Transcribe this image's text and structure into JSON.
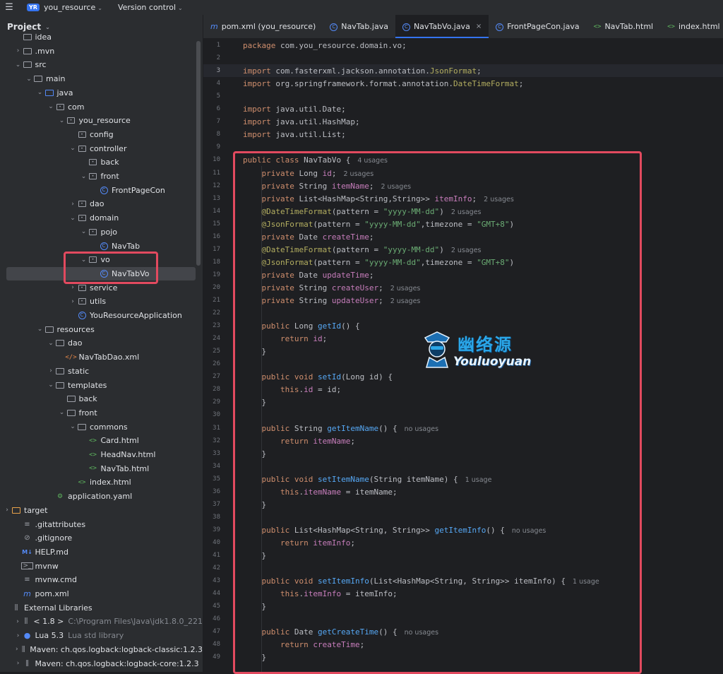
{
  "topbar": {
    "badge": "YR",
    "project": "you_resource",
    "version_control": "Version control"
  },
  "sidebar": {
    "title": "Project",
    "tree": [
      {
        "label": "idea",
        "depth": 1,
        "arrow": "",
        "icon": "folder"
      },
      {
        "label": ".mvn",
        "depth": 1,
        "arrow": "›",
        "icon": "folder"
      },
      {
        "label": "src",
        "depth": 1,
        "arrow": "⌄",
        "icon": "folder"
      },
      {
        "label": "main",
        "depth": 2,
        "arrow": "⌄",
        "icon": "folder"
      },
      {
        "label": "java",
        "depth": 3,
        "arrow": "⌄",
        "icon": "folder-blue"
      },
      {
        "label": "com",
        "depth": 4,
        "arrow": "⌄",
        "icon": "package"
      },
      {
        "label": "you_resource",
        "depth": 5,
        "arrow": "⌄",
        "icon": "package"
      },
      {
        "label": "config",
        "depth": 6,
        "arrow": "",
        "icon": "package"
      },
      {
        "label": "controller",
        "depth": 6,
        "arrow": "⌄",
        "icon": "package"
      },
      {
        "label": "back",
        "depth": 7,
        "arrow": "",
        "icon": "package"
      },
      {
        "label": "front",
        "depth": 7,
        "arrow": "⌄",
        "icon": "package"
      },
      {
        "label": "FrontPageCon",
        "depth": 8,
        "arrow": "",
        "icon": "class"
      },
      {
        "label": "dao",
        "depth": 6,
        "arrow": "›",
        "icon": "package"
      },
      {
        "label": "domain",
        "depth": 6,
        "arrow": "⌄",
        "icon": "package"
      },
      {
        "label": "pojo",
        "depth": 7,
        "arrow": "⌄",
        "icon": "package"
      },
      {
        "label": "NavTab",
        "depth": 8,
        "arrow": "",
        "icon": "class"
      },
      {
        "label": "vo",
        "depth": 7,
        "arrow": "⌄",
        "icon": "package"
      },
      {
        "label": "NavTabVo",
        "depth": 8,
        "arrow": "",
        "icon": "class",
        "selected": true
      },
      {
        "label": "service",
        "depth": 6,
        "arrow": "›",
        "icon": "package"
      },
      {
        "label": "utils",
        "depth": 6,
        "arrow": "›",
        "icon": "package"
      },
      {
        "label": "YouResourceApplication",
        "depth": 6,
        "arrow": "",
        "icon": "class"
      },
      {
        "label": "resources",
        "depth": 3,
        "arrow": "⌄",
        "icon": "folder"
      },
      {
        "label": "dao",
        "depth": 4,
        "arrow": "⌄",
        "icon": "folder"
      },
      {
        "label": "NavTabDao.xml",
        "depth": 5,
        "arrow": "",
        "icon": "xml"
      },
      {
        "label": "static",
        "depth": 4,
        "arrow": "›",
        "icon": "folder"
      },
      {
        "label": "templates",
        "depth": 4,
        "arrow": "⌄",
        "icon": "folder"
      },
      {
        "label": "back",
        "depth": 5,
        "arrow": "",
        "icon": "folder"
      },
      {
        "label": "front",
        "depth": 5,
        "arrow": "⌄",
        "icon": "folder"
      },
      {
        "label": "commons",
        "depth": 6,
        "arrow": "⌄",
        "icon": "folder"
      },
      {
        "label": "Card.html",
        "depth": 7,
        "arrow": "",
        "icon": "html"
      },
      {
        "label": "HeadNav.html",
        "depth": 7,
        "arrow": "",
        "icon": "html"
      },
      {
        "label": "NavTab.html",
        "depth": 7,
        "arrow": "",
        "icon": "html"
      },
      {
        "label": "index.html",
        "depth": 6,
        "arrow": "",
        "icon": "html"
      },
      {
        "label": "application.yaml",
        "depth": 4,
        "arrow": "",
        "icon": "yaml"
      },
      {
        "label": "target",
        "depth": 0,
        "arrow": "›",
        "icon": "folder-orange"
      },
      {
        "label": ".gitattributes",
        "depth": 1,
        "arrow": "",
        "icon": "text"
      },
      {
        "label": ".gitignore",
        "depth": 1,
        "arrow": "",
        "icon": "ignore"
      },
      {
        "label": "HELP.md",
        "depth": 1,
        "arrow": "",
        "icon": "md"
      },
      {
        "label": "mvnw",
        "depth": 1,
        "arrow": "",
        "icon": "terminal"
      },
      {
        "label": "mvnw.cmd",
        "depth": 1,
        "arrow": "",
        "icon": "text"
      },
      {
        "label": "pom.xml",
        "depth": 1,
        "arrow": "",
        "icon": "maven"
      },
      {
        "label": "External Libraries",
        "depth": 0,
        "arrow": "",
        "icon": "library"
      },
      {
        "label": "< 1.8 >",
        "sub": "C:\\Program Files\\Java\\jdk1.8.0_221",
        "depth": 1,
        "arrow": "›",
        "icon": "library"
      },
      {
        "label": "Lua 5.3",
        "sub": "Lua std library",
        "depth": 1,
        "arrow": "›",
        "icon": "lua"
      },
      {
        "label": "Maven: ch.qos.logback:logback-classic:1.2.3",
        "depth": 1,
        "arrow": "›",
        "icon": "library"
      },
      {
        "label": "Maven: ch.qos.logback:logback-core:1.2.3",
        "depth": 1,
        "arrow": "›",
        "icon": "library"
      }
    ]
  },
  "tabs": [
    {
      "label": "pom.xml (you_resource)",
      "icon": "m",
      "active": false
    },
    {
      "label": "NavTab.java",
      "icon": "class",
      "active": false
    },
    {
      "label": "NavTabVo.java",
      "icon": "class",
      "active": true,
      "close": "×"
    },
    {
      "label": "FrontPageCon.java",
      "icon": "class",
      "active": false
    },
    {
      "label": "NavTab.html",
      "icon": "html",
      "active": false
    },
    {
      "label": "index.html",
      "icon": "html",
      "active": false
    }
  ],
  "editor": {
    "current_line": 3,
    "lines": [
      [
        [
          "kw",
          "package "
        ],
        [
          "",
          "com.you_resource.domain.vo;"
        ]
      ],
      [],
      [
        [
          "kw",
          "import "
        ],
        [
          "",
          "com.fasterxml.jackson.annotation."
        ],
        [
          "ann",
          "JsonFormat"
        ],
        [
          "",
          ";"
        ]
      ],
      [
        [
          "kw",
          "import "
        ],
        [
          "",
          "org.springframework.format.annotation."
        ],
        [
          "ann",
          "DateTimeFormat"
        ],
        [
          "",
          ";"
        ]
      ],
      [],
      [
        [
          "kw",
          "import "
        ],
        [
          "",
          "java.util.Date;"
        ]
      ],
      [
        [
          "kw",
          "import "
        ],
        [
          "",
          "java.util.HashMap;"
        ]
      ],
      [
        [
          "kw",
          "import "
        ],
        [
          "",
          "java.util.List;"
        ]
      ],
      [],
      [
        [
          "kw",
          "public class "
        ],
        [
          "",
          "NavTabVo {"
        ],
        [
          "hint",
          "4 usages"
        ]
      ],
      [
        [
          "",
          "    "
        ],
        [
          "kw",
          "private "
        ],
        [
          "",
          "Long "
        ],
        [
          "fld",
          "id"
        ],
        [
          "",
          ";"
        ],
        [
          "hint",
          "2 usages"
        ]
      ],
      [
        [
          "",
          "    "
        ],
        [
          "kw",
          "private "
        ],
        [
          "",
          "String "
        ],
        [
          "fld",
          "itemName"
        ],
        [
          "",
          ";"
        ],
        [
          "hint",
          "2 usages"
        ]
      ],
      [
        [
          "",
          "    "
        ],
        [
          "kw",
          "private "
        ],
        [
          "",
          "List<HashMap<String,String>> "
        ],
        [
          "fld",
          "itemInfo"
        ],
        [
          "",
          ";"
        ],
        [
          "hint",
          "2 usages"
        ]
      ],
      [
        [
          "",
          "    "
        ],
        [
          "ann",
          "@DateTimeFormat"
        ],
        [
          "",
          "(pattern = "
        ],
        [
          "str",
          "\"yyyy-MM-dd\""
        ],
        [
          "",
          ")"
        ],
        [
          "hint",
          "2 usages"
        ]
      ],
      [
        [
          "",
          "    "
        ],
        [
          "ann",
          "@JsonFormat"
        ],
        [
          "",
          "(pattern = "
        ],
        [
          "str",
          "\"yyyy-MM-dd\""
        ],
        [
          "",
          ",timezone = "
        ],
        [
          "str",
          "\"GMT+8\""
        ],
        [
          "",
          ")"
        ]
      ],
      [
        [
          "",
          "    "
        ],
        [
          "kw",
          "private "
        ],
        [
          "",
          "Date "
        ],
        [
          "fld",
          "createTime"
        ],
        [
          "",
          ";"
        ]
      ],
      [
        [
          "",
          "    "
        ],
        [
          "ann",
          "@DateTimeFormat"
        ],
        [
          "",
          "(pattern = "
        ],
        [
          "str",
          "\"yyyy-MM-dd\""
        ],
        [
          "",
          ")"
        ],
        [
          "hint",
          "2 usages"
        ]
      ],
      [
        [
          "",
          "    "
        ],
        [
          "ann",
          "@JsonFormat"
        ],
        [
          "",
          "(pattern = "
        ],
        [
          "str",
          "\"yyyy-MM-dd\""
        ],
        [
          "",
          ",timezone = "
        ],
        [
          "str",
          "\"GMT+8\""
        ],
        [
          "",
          ")"
        ]
      ],
      [
        [
          "",
          "    "
        ],
        [
          "kw",
          "private "
        ],
        [
          "",
          "Date "
        ],
        [
          "fld",
          "updateTime"
        ],
        [
          "",
          ";"
        ]
      ],
      [
        [
          "",
          "    "
        ],
        [
          "kw",
          "private "
        ],
        [
          "",
          "String "
        ],
        [
          "fld",
          "createUser"
        ],
        [
          "",
          ";"
        ],
        [
          "hint",
          "2 usages"
        ]
      ],
      [
        [
          "",
          "    "
        ],
        [
          "kw",
          "private "
        ],
        [
          "",
          "String "
        ],
        [
          "fld",
          "updateUser"
        ],
        [
          "",
          ";"
        ],
        [
          "hint",
          "2 usages"
        ]
      ],
      [],
      [
        [
          "",
          "    "
        ],
        [
          "kw",
          "public "
        ],
        [
          "",
          "Long "
        ],
        [
          "mth",
          "getId"
        ],
        [
          "",
          "() {"
        ]
      ],
      [
        [
          "",
          "        "
        ],
        [
          "kw",
          "return "
        ],
        [
          "fld",
          "id"
        ],
        [
          "",
          ";"
        ]
      ],
      [
        [
          "",
          "    }"
        ]
      ],
      [],
      [
        [
          "",
          "    "
        ],
        [
          "kw",
          "public void "
        ],
        [
          "mth",
          "setId"
        ],
        [
          "",
          "(Long id) {"
        ]
      ],
      [
        [
          "",
          "        "
        ],
        [
          "kw",
          "this"
        ],
        [
          "",
          "."
        ],
        [
          "fld",
          "id"
        ],
        [
          "",
          " = id;"
        ]
      ],
      [
        [
          "",
          "    }"
        ]
      ],
      [],
      [
        [
          "",
          "    "
        ],
        [
          "kw",
          "public "
        ],
        [
          "",
          "String "
        ],
        [
          "mth",
          "getItemName"
        ],
        [
          "",
          "() {"
        ],
        [
          "hint",
          "no usages"
        ]
      ],
      [
        [
          "",
          "        "
        ],
        [
          "kw",
          "return "
        ],
        [
          "fld",
          "itemName"
        ],
        [
          "",
          ";"
        ]
      ],
      [
        [
          "",
          "    }"
        ]
      ],
      [],
      [
        [
          "",
          "    "
        ],
        [
          "kw",
          "public void "
        ],
        [
          "mth",
          "setItemName"
        ],
        [
          "",
          "(String itemName) {"
        ],
        [
          "hint",
          "1 usage"
        ]
      ],
      [
        [
          "",
          "        "
        ],
        [
          "kw",
          "this"
        ],
        [
          "",
          "."
        ],
        [
          "fld",
          "itemName"
        ],
        [
          "",
          " = itemName;"
        ]
      ],
      [
        [
          "",
          "    }"
        ]
      ],
      [],
      [
        [
          "",
          "    "
        ],
        [
          "kw",
          "public "
        ],
        [
          "",
          "List<HashMap<String, String>> "
        ],
        [
          "mth",
          "getItemInfo"
        ],
        [
          "",
          "() {"
        ],
        [
          "hint",
          "no usages"
        ]
      ],
      [
        [
          "",
          "        "
        ],
        [
          "kw",
          "return "
        ],
        [
          "fld",
          "itemInfo"
        ],
        [
          "",
          ";"
        ]
      ],
      [
        [
          "",
          "    }"
        ]
      ],
      [],
      [
        [
          "",
          "    "
        ],
        [
          "kw",
          "public void "
        ],
        [
          "mth",
          "setItemInfo"
        ],
        [
          "",
          "(List<HashMap<String, String>> itemInfo) {"
        ],
        [
          "hint",
          "1 usage"
        ]
      ],
      [
        [
          "",
          "        "
        ],
        [
          "kw",
          "this"
        ],
        [
          "",
          "."
        ],
        [
          "fld",
          "itemInfo"
        ],
        [
          "",
          " = itemInfo;"
        ]
      ],
      [
        [
          "",
          "    }"
        ]
      ],
      [],
      [
        [
          "",
          "    "
        ],
        [
          "kw",
          "public "
        ],
        [
          "",
          "Date "
        ],
        [
          "mth",
          "getCreateTime"
        ],
        [
          "",
          "() {"
        ],
        [
          "hint",
          "no usages"
        ]
      ],
      [
        [
          "",
          "        "
        ],
        [
          "kw",
          "return "
        ],
        [
          "fld",
          "createTime"
        ],
        [
          "",
          ";"
        ]
      ],
      [
        [
          "",
          "    }"
        ]
      ]
    ]
  },
  "watermark": {
    "cn": "幽络源",
    "en": "Youluoyuan"
  },
  "colors": {
    "highlight": "#e24a5f",
    "accent": "#3574f0"
  }
}
